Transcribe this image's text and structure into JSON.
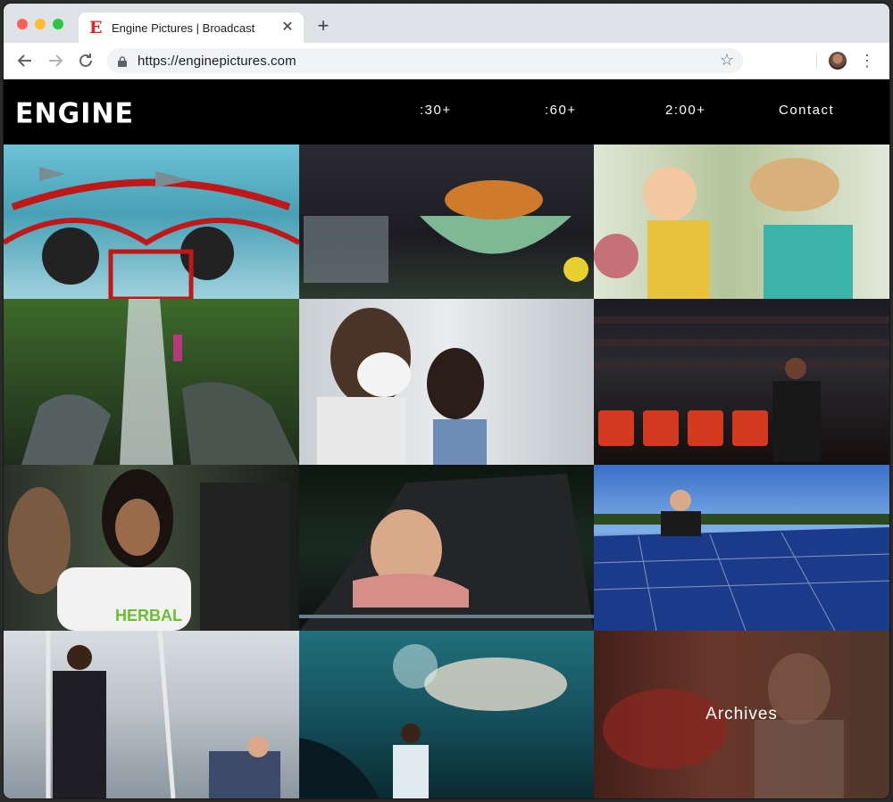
{
  "browser": {
    "tab_title": "Engine Pictures | Broadcast",
    "favicon_letter": "E",
    "url": "https://enginepictures.com"
  },
  "site": {
    "logo": "ENGINE",
    "nav": [
      ":30+",
      ":60+",
      "2:00+",
      "Contact"
    ],
    "archives_label": "Archives"
  },
  "colors": {
    "brand_red": "#e0242a",
    "background": "#000000"
  }
}
